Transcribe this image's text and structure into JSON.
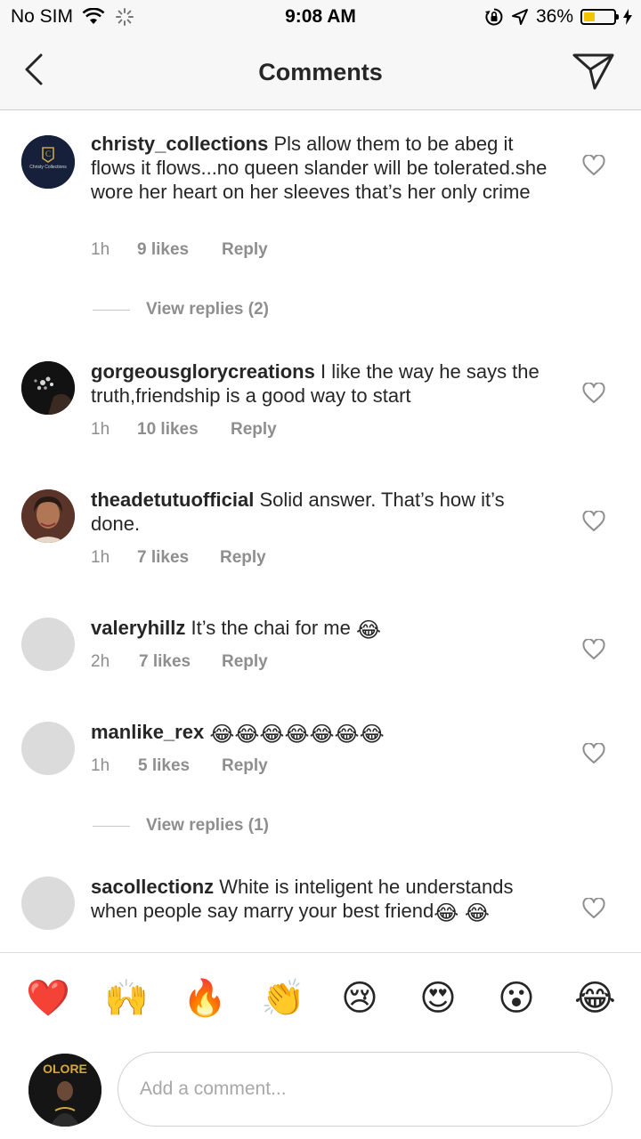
{
  "status_bar": {
    "carrier": "No SIM",
    "time": "9:08 AM",
    "battery_percent_label": "36%",
    "battery_level": 0.36,
    "battery_color": "#f5c400"
  },
  "nav": {
    "title": "Comments",
    "back_icon": "chevron-left-icon",
    "share_icon": "paper-plane-icon"
  },
  "comments": [
    {
      "username": "christy_collections",
      "text": "Pls allow them to be abeg it flows it flows...no queen slander will be tolerated.she wore her heart on her sleeves that’s her only crime",
      "time": "1h",
      "likes": "9 likes",
      "reply": "Reply",
      "view_replies": "View replies (2)",
      "avatar_label": "Christy Collections"
    },
    {
      "username": "gorgeousglorycreations",
      "text": "I like the way he says the truth,friendship is a good way to start",
      "time": "1h",
      "likes": "10 likes",
      "reply": "Reply"
    },
    {
      "username": "theadetutuofficial",
      "text": "Solid answer. That’s how it’s done.",
      "time": "1h",
      "likes": "7 likes",
      "reply": "Reply"
    },
    {
      "username": "valeryhillz",
      "text": "It’s the chai for me",
      "emojis": "😂",
      "time": "2h",
      "likes": "7 likes",
      "reply": "Reply"
    },
    {
      "username": "manlike_rex",
      "text": "",
      "emojis": "😂😂😂😂😂😂😂",
      "time": "1h",
      "likes": "5 likes",
      "reply": "Reply",
      "view_replies": "View replies (1)"
    },
    {
      "username": "sacollectionz",
      "text": "White is inteligent he understands when people say marry your best friend",
      "emojis": "😂 😂"
    }
  ],
  "emoji_bar": [
    "❤️",
    "🙌",
    "🔥",
    "👏",
    "😢",
    "😍",
    "😮",
    "😂"
  ],
  "composer": {
    "placeholder": "Add a comment...",
    "avatar_label": "OLORE"
  }
}
